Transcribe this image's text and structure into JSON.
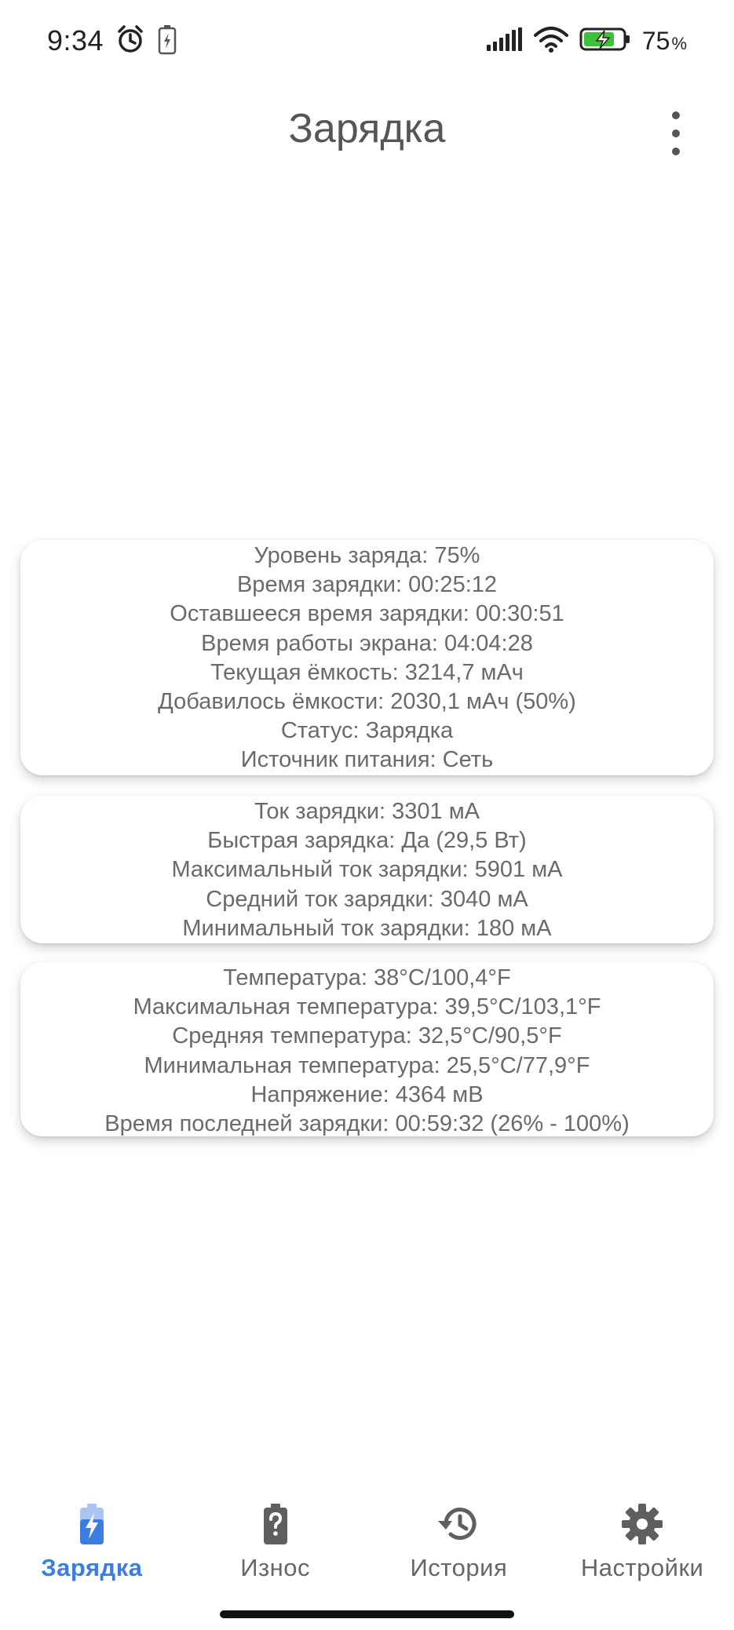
{
  "status_bar": {
    "time": "9:34",
    "battery_percent": "75",
    "percent_symbol": "%"
  },
  "app_bar": {
    "title": "Зарядка"
  },
  "cards": {
    "charge": [
      "Уровень заряда: 75%",
      "Время зарядки: 00:25:12",
      "Оставшееся время зарядки: 00:30:51",
      "Время работы экрана: 04:04:28",
      "Текущая ёмкость: 3214,7 мАч",
      "Добавилось ёмкости: 2030,1 мАч (50%)",
      "Статус: Зарядка",
      "Источник питания: Сеть"
    ],
    "current": [
      "Ток зарядки: 3301 мА",
      "Быстрая зарядка: Да (29,5 Вт)",
      "Максимальный ток зарядки: 5901 мА",
      "Средний ток зарядки: 3040 мА",
      "Минимальный ток зарядки: 180 мА"
    ],
    "temperature": [
      "Температура: 38°C/100,4°F",
      "Максимальная температура: 39,5°C/103,1°F",
      "Средняя температура: 32,5°C/90,5°F",
      "Минимальная температура: 25,5°C/77,9°F",
      "Напряжение: 4364 мВ",
      "Время последней зарядки: 00:59:32 (26% - 100%)"
    ]
  },
  "bottom_nav": {
    "items": [
      {
        "label": "Зарядка",
        "icon": "battery-charging-icon",
        "active": true
      },
      {
        "label": "Износ",
        "icon": "battery-unknown-icon",
        "active": false
      },
      {
        "label": "История",
        "icon": "history-icon",
        "active": false
      },
      {
        "label": "Настройки",
        "icon": "settings-gear-icon",
        "active": false
      }
    ]
  },
  "colors": {
    "accent": "#3b7de0",
    "text_secondary": "#6a6a6a",
    "icon_gray": "#5f5f5f",
    "battery_charging_green": "#3cc13b"
  }
}
